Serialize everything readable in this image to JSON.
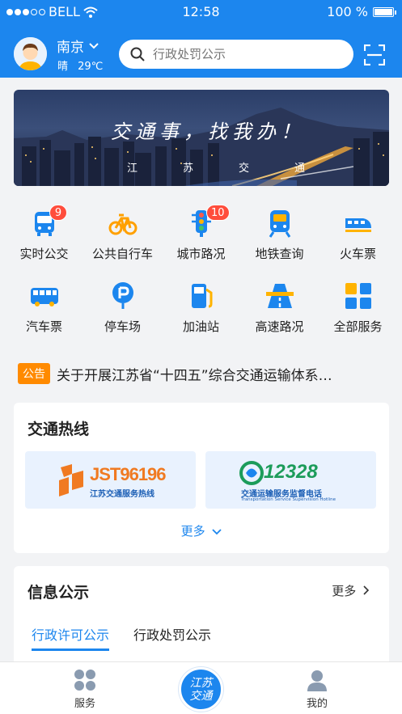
{
  "status_bar": {
    "carrier": "BELL",
    "time": "12:58",
    "battery": "100 %",
    "battery_level": 1.0
  },
  "header": {
    "city": "南京",
    "weather": "晴",
    "temperature": "29℃",
    "search_placeholder": "行政处罚公示"
  },
  "banner": {
    "title": "交通事，找我办！",
    "subtitle_chars": [
      "江",
      "苏",
      "交",
      "通"
    ]
  },
  "services": [
    {
      "label": "实时公交",
      "icon": "bus-icon",
      "badge": "9",
      "color": "#1c86ee"
    },
    {
      "label": "公共自行车",
      "icon": "bicycle-icon",
      "badge": "",
      "color": "#ffa000"
    },
    {
      "label": "城市路况",
      "icon": "traffic-light-icon",
      "badge": "10",
      "color": "#1c86ee"
    },
    {
      "label": "地铁查询",
      "icon": "metro-icon",
      "badge": "",
      "color": "#1c86ee"
    },
    {
      "label": "火车票",
      "icon": "train-icon",
      "badge": "",
      "color": "#1c86ee"
    },
    {
      "label": "汽车票",
      "icon": "coach-icon",
      "badge": "",
      "color": "#1c86ee"
    },
    {
      "label": "停车场",
      "icon": "parking-icon",
      "badge": "",
      "color": "#1c86ee"
    },
    {
      "label": "加油站",
      "icon": "gas-station-icon",
      "badge": "",
      "color": "#1c86ee"
    },
    {
      "label": "高速路况",
      "icon": "highway-icon",
      "badge": "",
      "color": "#1c86ee"
    },
    {
      "label": "全部服务",
      "icon": "all-services-icon",
      "badge": "",
      "color": "#1c86ee"
    }
  ],
  "notice": {
    "tag": "公告",
    "text": "关于开展江苏省“十四五”综合交通运输体系…"
  },
  "hotline": {
    "title": "交通热线",
    "items": [
      {
        "number": "JST96196",
        "caption": "江苏交通服务热线"
      },
      {
        "number": "12328",
        "caption": "交通运输服务监督电话",
        "caption_en": "Transportation Service Supervision Hotline"
      }
    ],
    "more": "更多"
  },
  "info": {
    "title": "信息公示",
    "more": "更多",
    "tabs": [
      "行政许可公示",
      "行政处罚公示"
    ],
    "active_tab": 0
  },
  "tabbar": {
    "items": [
      {
        "label": "服务"
      },
      {
        "label": "江苏交通"
      },
      {
        "label": "我的"
      }
    ]
  },
  "colors": {
    "primary": "#1c86ee",
    "badge": "#ff4d3c",
    "notice": "#ff8a00",
    "bike": "#ffa000"
  }
}
